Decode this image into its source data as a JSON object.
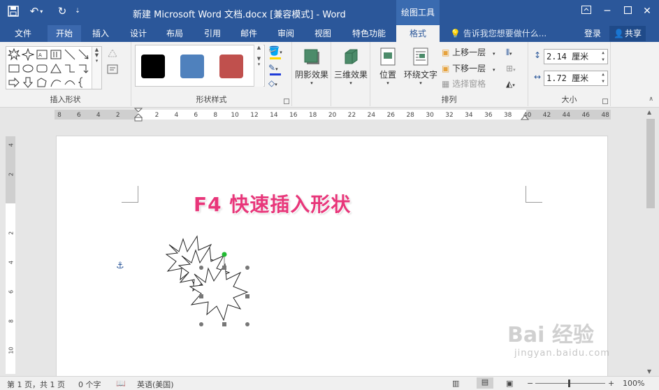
{
  "titlebar": {
    "title": "新建 Microsoft Word 文档.docx [兼容模式] - Word",
    "contextual_tools": "绘图工具"
  },
  "tabs": [
    "文件",
    "开始",
    "插入",
    "设计",
    "布局",
    "引用",
    "邮件",
    "审阅",
    "视图",
    "特色功能",
    "格式"
  ],
  "tellme_placeholder": "告诉我您想要做什么...",
  "login_label": "登录",
  "share_label": "共享",
  "ribbon": {
    "insert_shapes_label": "插入形状",
    "shape_styles_label": "形状样式",
    "shadow_effects_label": "阴影效果",
    "three_d_effects_label": "三维效果",
    "arrange_label": "排列",
    "position_label": "位置",
    "wrap_text_label": "环绕文字",
    "bring_forward_label": "上移一层",
    "send_backward_label": "下移一层",
    "selection_pane_label": "选择窗格",
    "size_label": "大小",
    "height_value": "2.14 厘米",
    "width_value": "1.72 厘米",
    "style_colors": [
      "#000000",
      "#4f81bd",
      "#c0504d"
    ]
  },
  "ruler": {
    "ticks": [
      "8",
      "6",
      "4",
      "2",
      "",
      "2",
      "4",
      "6",
      "8",
      "10",
      "12",
      "14",
      "16",
      "18",
      "20",
      "22",
      "24",
      "26",
      "28",
      "30",
      "32",
      "34",
      "36",
      "38",
      "40",
      "42",
      "44",
      "46",
      "48"
    ],
    "vticks": [
      "4",
      "2",
      "",
      "2",
      "4",
      "6",
      "8",
      "10"
    ]
  },
  "document": {
    "heading": "F4 快速插入形状"
  },
  "statusbar": {
    "page_info": "第 1 页，共 1 页",
    "word_count": "0 个字",
    "language": "英语(美国)",
    "zoom": "100%"
  },
  "watermark": {
    "logo_text": "Bai 经验",
    "url": "jingyan.baidu.com"
  },
  "colors": {
    "title_blue": "#2b579a",
    "heading_pink": "#e8367a",
    "handle_green": "#22bb33"
  }
}
